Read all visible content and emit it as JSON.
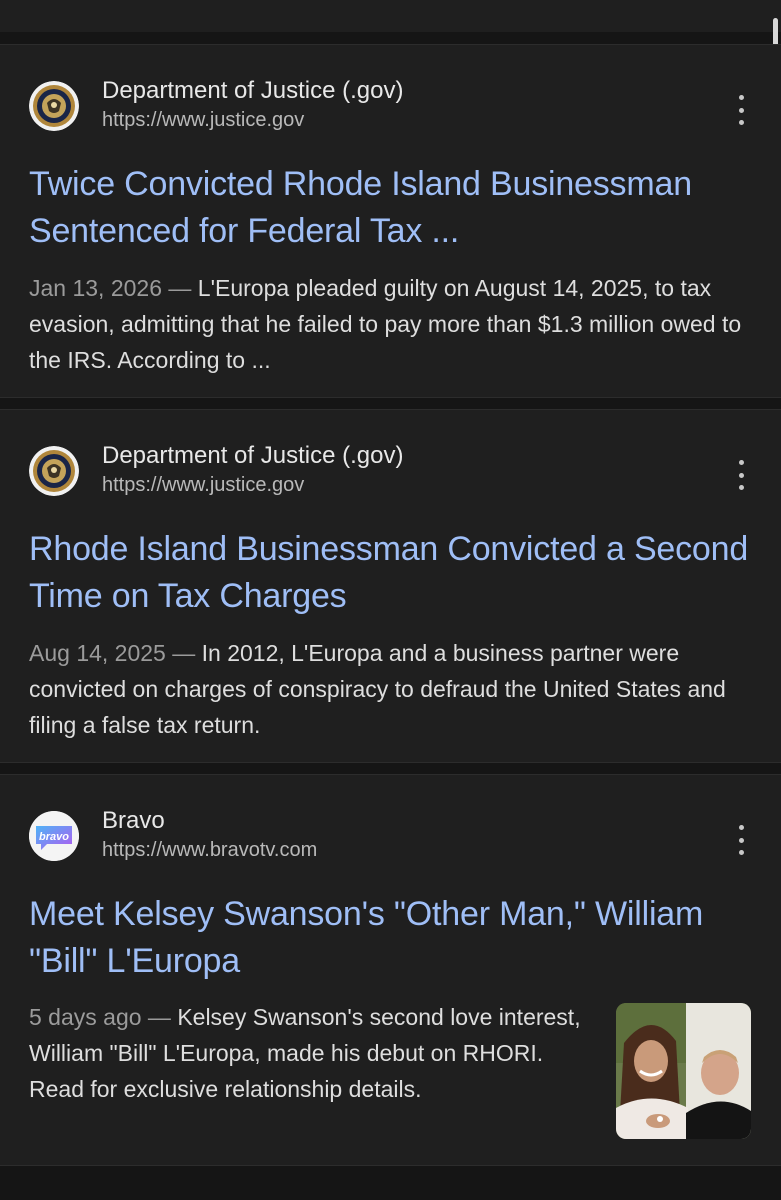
{
  "results": [
    {
      "site_name": "Department of Justice (.gov)",
      "site_url": "https://www.justice.gov",
      "favicon": "doj-seal-icon",
      "title": "Twice Convicted Rhode Island Businessman Sentenced for Federal Tax ...",
      "date": "Jan 13, 2026",
      "separator": " — ",
      "snippet": "L'Europa pleaded guilty on August 14, 2025, to tax evasion, admitting that he failed to pay more than $1.3 million owed to the IRS. According to ..."
    },
    {
      "site_name": "Department of Justice (.gov)",
      "site_url": "https://www.justice.gov",
      "favicon": "doj-seal-icon",
      "title": "Rhode Island Businessman Convicted a Second Time on Tax Charges",
      "date": "Aug 14, 2025",
      "separator": " — ",
      "snippet": "In 2012, L'Europa and a business partner were convicted on charges of conspiracy to defraud the United States and filing a false tax return."
    },
    {
      "site_name": "Bravo",
      "site_url": "https://www.bravotv.com",
      "favicon": "bravo-logo-icon",
      "favicon_text": "bravo",
      "title": "Meet Kelsey Swanson's \"Other Man,\" William \"Bill\" L'Europa",
      "date": "5 days ago",
      "separator": " — ",
      "snippet": "Kelsey Swanson's second love interest, William \"Bill\" L'Europa, made his debut on RHORI. Read for exclusive relationship details.",
      "thumbnail": "people-photo-thumbnail"
    }
  ],
  "colors": {
    "background": "#151515",
    "card": "#1f1f1f",
    "link": "#9fbef6",
    "text": "#dedede",
    "muted": "#9b9b9b"
  }
}
